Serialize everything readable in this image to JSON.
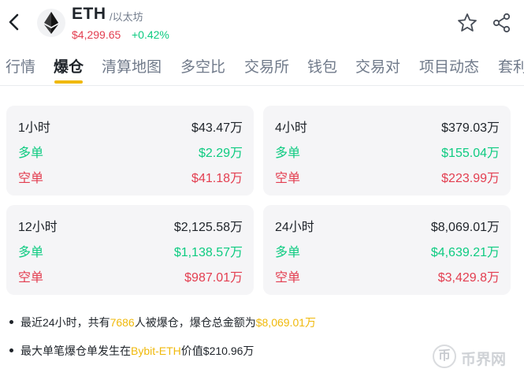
{
  "header": {
    "symbol": "ETH",
    "name": "/以太坊",
    "price": "$4,299.65",
    "change": "+0.42%"
  },
  "tabs": [
    "行情",
    "爆仓",
    "清算地图",
    "多空比",
    "交易所",
    "钱包",
    "交易对",
    "项目动态",
    "套利"
  ],
  "active_tab": "爆仓",
  "cards": [
    {
      "period": "1小时",
      "total": "$43.47万",
      "long_label": "多单",
      "long": "$2.29万",
      "short_label": "空单",
      "short": "$41.18万"
    },
    {
      "period": "4小时",
      "total": "$379.03万",
      "long_label": "多单",
      "long": "$155.04万",
      "short_label": "空单",
      "short": "$223.99万"
    },
    {
      "period": "12小时",
      "total": "$2,125.58万",
      "long_label": "多单",
      "long": "$1,138.57万",
      "short_label": "空单",
      "short": "$987.01万"
    },
    {
      "period": "24小时",
      "total": "$8,069.01万",
      "long_label": "多单",
      "long": "$4,639.21万",
      "short_label": "空单",
      "short": "$3,429.8万"
    }
  ],
  "notes": {
    "n1_a": "最近24小时，共有",
    "n1_count": "7686",
    "n1_b": "人被爆仓，爆仓总金额为",
    "n1_amount": "$8,069.01万",
    "n2_a": "最大单笔爆仓单发生在",
    "n2_exchange": "Bybit-ETH",
    "n2_b": "价值$210.96万"
  },
  "watermark": {
    "badge": "币",
    "text": "币界网"
  },
  "colors": {
    "up": "#0ecb81",
    "down": "#e33e50",
    "accent": "#f0b90b",
    "card_bg": "#f5f5f7"
  },
  "icons": [
    "back-arrow-icon",
    "ethereum-logo-icon",
    "star-icon",
    "share-icon"
  ]
}
